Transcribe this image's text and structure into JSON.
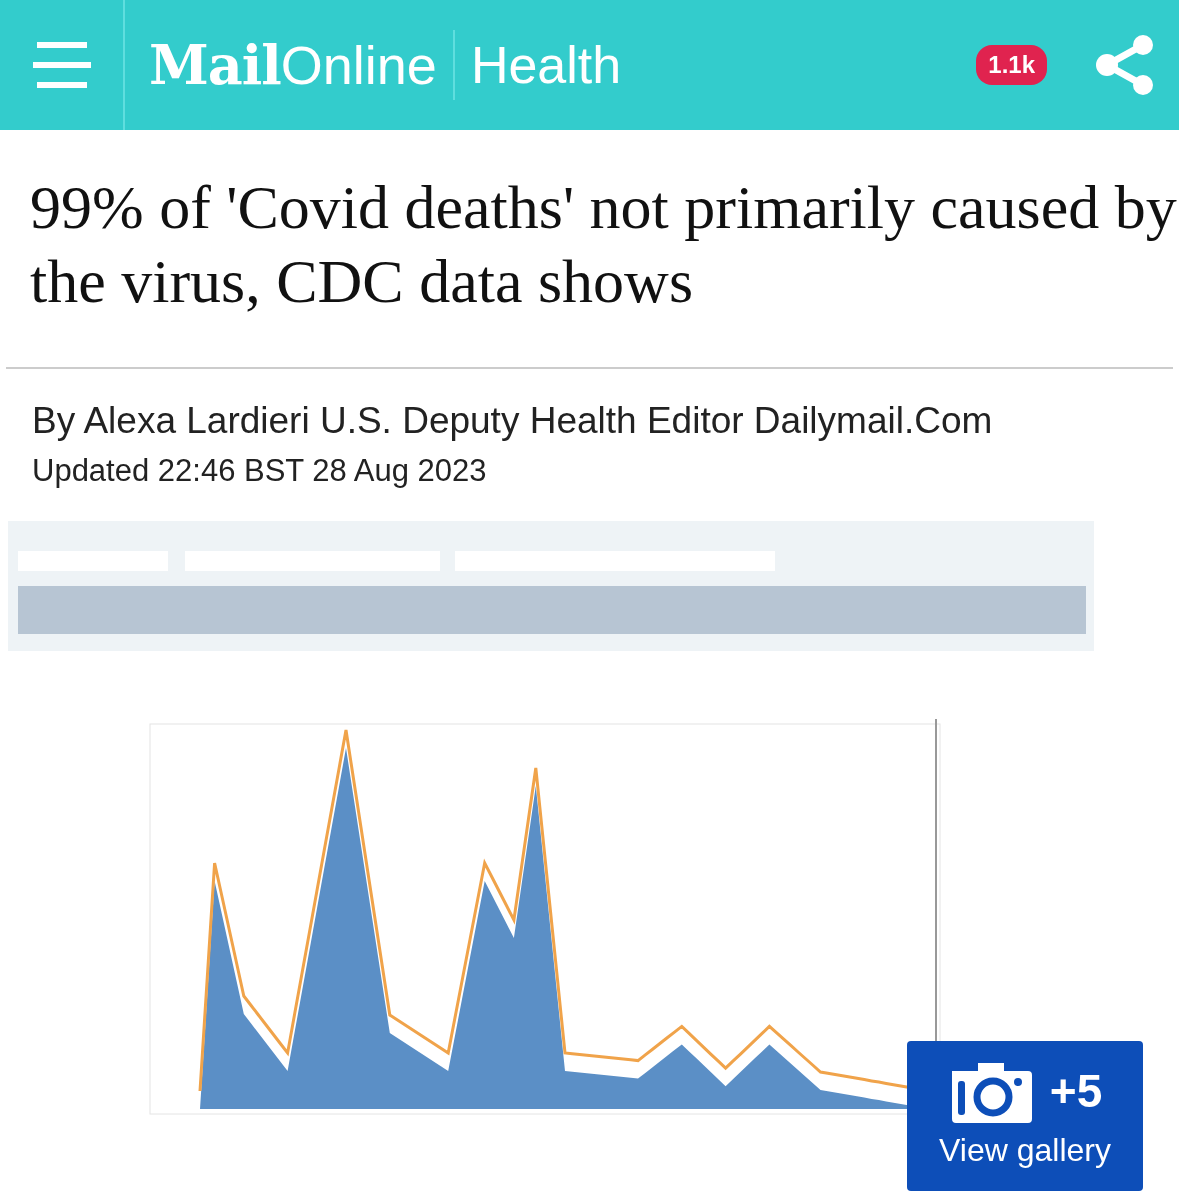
{
  "header": {
    "logo_main": "Mail",
    "logo_sub": "Online",
    "section": "Health",
    "comment_count": "1.1k"
  },
  "article": {
    "headline": "99% of 'Covid deaths' not primarily caused by the virus, CDC data shows",
    "byline": "By Alexa Lardieri U.S. Deputy Health Editor Dailymail.Com",
    "updated": "Updated 22:46 BST 28 Aug 2023"
  },
  "image": {
    "kind": "picture",
    "gallery_count": "+5",
    "gallery_label": "View gallery"
  }
}
